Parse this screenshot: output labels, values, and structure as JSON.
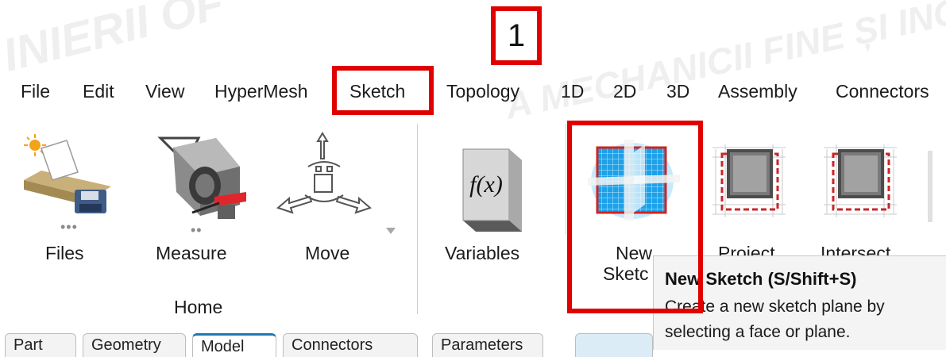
{
  "watermark": {
    "left_text": "INIERII OF",
    "right_text": "A MECHANICII FINE ȘI INGINERII",
    "color": "#f0f0f0"
  },
  "step_badge": {
    "number": "1",
    "color": "#e00000"
  },
  "menubar": {
    "items": [
      "File",
      "Edit",
      "View",
      "HyperMesh",
      "Sketch",
      "Topology",
      "1D",
      "2D",
      "3D",
      "Assembly",
      "Connectors"
    ],
    "highlighted": "Sketch"
  },
  "ribbon": {
    "home_tools": [
      {
        "label": "Files",
        "icon": "files-icon",
        "has_more": true
      },
      {
        "label": "Measure",
        "icon": "measure-icon",
        "has_more": true
      },
      {
        "label": "Move",
        "icon": "move-icon",
        "has_dropdown": true
      }
    ],
    "home_group_label": "Home",
    "sketch_tools": [
      {
        "label": "Variables",
        "icon": "function-fx-icon"
      },
      {
        "label": "New Sketch",
        "label_visible_line1": "New",
        "label_visible_line2": "Sketc",
        "icon": "new-sketch-icon",
        "highlighted": true
      },
      {
        "label": "Project",
        "icon": "project-icon"
      },
      {
        "label": "Intersect",
        "icon": "intersect-icon"
      }
    ],
    "fx_glyph": "f(x)"
  },
  "tooltip": {
    "title": "New Sketch (S/Shift+S)",
    "line1": "Create a new sketch plane by",
    "line2": "selecting a face or plane."
  },
  "bottom_tabs": [
    "Part",
    "Geometry",
    "Model",
    "Connectors",
    "Parameters"
  ],
  "colors": {
    "accent_red": "#e00000",
    "sketch_blue": "#29a3e6",
    "tooltip_bg": "#f4f4f4"
  }
}
